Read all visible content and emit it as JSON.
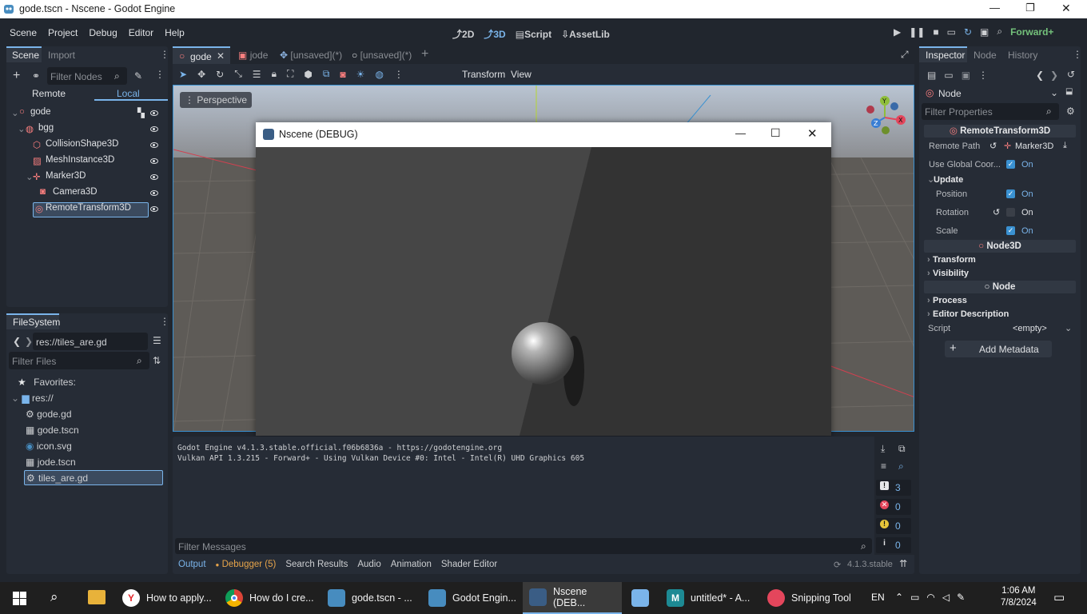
{
  "window": {
    "title": "gode.tscn - Nscene - Godot Engine",
    "min": "—",
    "max": "❐",
    "close": "✕"
  },
  "menu": [
    "Scene",
    "Project",
    "Debug",
    "Editor",
    "Help"
  ],
  "modes": {
    "m2d": "2D",
    "m3d": "3D",
    "script": "Script",
    "assetlib": "AssetLib"
  },
  "renderer": "Forward+",
  "scene_dock": {
    "tabs": [
      "Scene",
      "Import"
    ],
    "filter_placeholder": "Filter Nodes",
    "remote": "Remote",
    "local": "Local",
    "nodes": [
      {
        "label": "gode"
      },
      {
        "label": "bgg"
      },
      {
        "label": "CollisionShape3D"
      },
      {
        "label": "MeshInstance3D"
      },
      {
        "label": "Marker3D"
      },
      {
        "label": "Camera3D"
      },
      {
        "label": "RemoteTransform3D"
      }
    ]
  },
  "filesystem": {
    "tab": "FileSystem",
    "path": "res://tiles_are.gd",
    "filter_placeholder": "Filter Files",
    "favorites": "Favorites:",
    "root": "res://",
    "files": [
      "gode.gd",
      "gode.tscn",
      "icon.svg",
      "jode.tscn",
      "tiles_are.gd"
    ]
  },
  "editor_tabs": [
    "gode",
    "jode",
    "[unsaved](*)",
    "[unsaved](*)"
  ],
  "toolbar": {
    "transform": "Transform",
    "view": "View"
  },
  "viewport": {
    "perspective": "Perspective",
    "gizmo": {
      "x": "X",
      "y": "Y",
      "z": "Z"
    }
  },
  "debug_window": {
    "title": "Nscene (DEBUG)"
  },
  "output": {
    "lines": [
      "Godot Engine v4.1.3.stable.official.f06b6836a - https://godotengine.org",
      "Vulkan API 1.3.215 - Forward+ - Using Vulkan Device #0: Intel - Intel(R) UHD Graphics 605"
    ],
    "counts": [
      "3",
      "0",
      "0",
      "0"
    ],
    "filter_placeholder": "Filter Messages",
    "tabs": [
      "Output",
      "Debugger (5)",
      "Search Results",
      "Audio",
      "Animation",
      "Shader Editor"
    ],
    "version": "4.1.3.stable"
  },
  "inspector": {
    "tabs": [
      "Inspector",
      "Node",
      "History"
    ],
    "node": "Node",
    "filter_placeholder": "Filter Properties",
    "section_remote": "RemoteTransform3D",
    "remote_path_label": "Remote Path",
    "remote_path_value": "Marker3D",
    "use_global_label": "Use Global Coor...",
    "on": "On",
    "update": "Update",
    "position": "Position",
    "rotation": "Rotation",
    "scale": "Scale",
    "node3d": "Node3D",
    "transform": "Transform",
    "visibility": "Visibility",
    "process": "Process",
    "editor_description": "Editor Description",
    "script_label": "Script",
    "script_value": "<empty>",
    "add_metadata": "Add Metadata"
  },
  "taskbar": {
    "apps": [
      "How to apply...",
      "How do I cre...",
      "gode.tscn - ...",
      "Godot Engin...",
      "Nscene (DEB...",
      "",
      "untitled* - A...",
      "Snipping Tool"
    ],
    "lang": "EN",
    "time": "1:06 AM",
    "date": "7/8/2024"
  }
}
